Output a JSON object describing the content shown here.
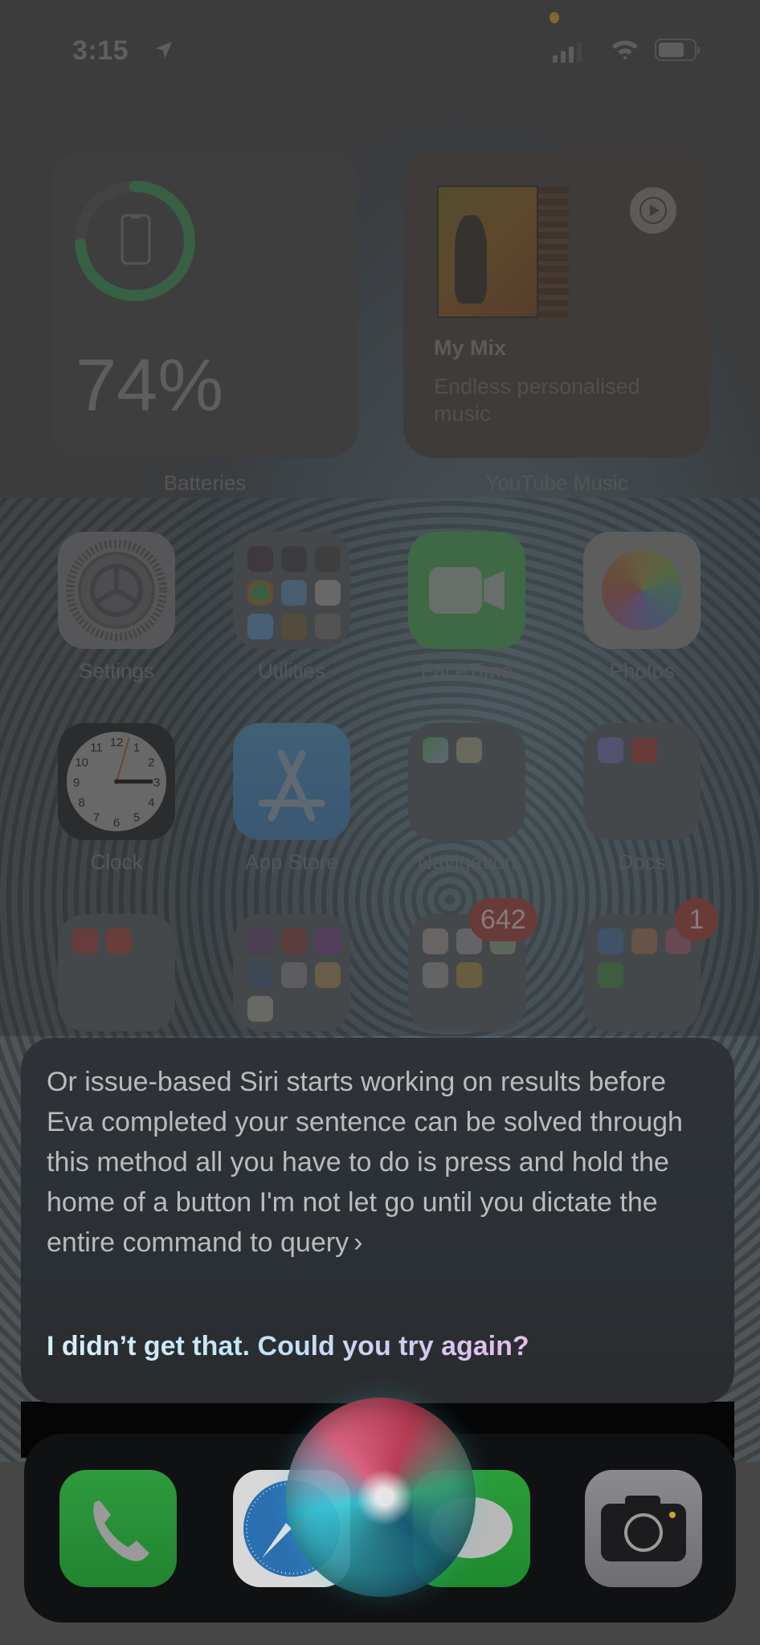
{
  "status_bar": {
    "time": "3:15",
    "location_icon": "location-arrow-icon",
    "signal_bars": 3,
    "wifi_icon": "wifi-icon",
    "battery_level_fraction": 0.74,
    "privacy_indicator_color": "#b08a3e"
  },
  "widgets": {
    "batteries": {
      "label": "Batteries",
      "percent_text": "74%",
      "charge_fraction": 0.74,
      "device_icon": "iphone-icon",
      "ring_color": "#3f7e55"
    },
    "youtube_music": {
      "label": "YouTube Music",
      "title": "My Mix",
      "subtitle": "Endless personalised music",
      "play_icon": "play-icon"
    }
  },
  "apps": {
    "row1": [
      {
        "name": "Settings",
        "type": "app"
      },
      {
        "name": "Utilities",
        "type": "folder"
      },
      {
        "name": "FaceTime",
        "type": "app"
      },
      {
        "name": "Photos",
        "type": "app"
      }
    ],
    "row2": [
      {
        "name": "Clock",
        "type": "app"
      },
      {
        "name": "App Store",
        "type": "app"
      },
      {
        "name": "Navigation",
        "type": "folder"
      },
      {
        "name": "Docs",
        "type": "folder"
      }
    ],
    "row3": [
      {
        "name": "",
        "type": "folder",
        "badge": ""
      },
      {
        "name": "",
        "type": "folder",
        "badge": ""
      },
      {
        "name": "",
        "type": "folder",
        "badge": "642"
      },
      {
        "name": "",
        "type": "folder",
        "badge": "1"
      }
    ]
  },
  "clock_numbers": [
    "12",
    "1",
    "2",
    "3",
    "4",
    "5",
    "6",
    "7",
    "8",
    "9",
    "10",
    "11"
  ],
  "siri": {
    "transcript": "Or issue-based Siri starts working on results before Eva completed your sentence can be solved through this method all you have to do is press and hold the home of a button I'm not let go until you dictate the entire command to query",
    "chevron": "›",
    "response": "I didn’t get that. Could you try again?"
  },
  "dock": {
    "apps": [
      "Phone",
      "Safari",
      "Messages",
      "Camera"
    ]
  }
}
